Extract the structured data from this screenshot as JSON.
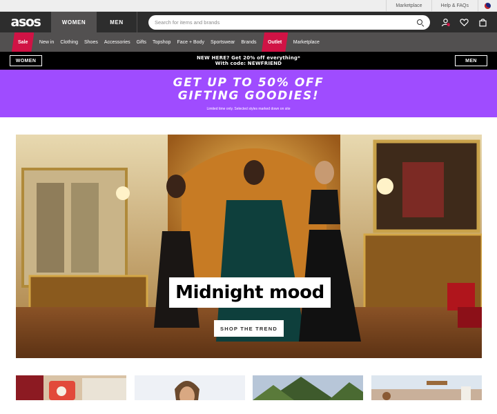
{
  "utility_bar": {
    "links": [
      "Marketplace",
      "Help & FAQs"
    ],
    "country_flag_icon": "flag-icon"
  },
  "header": {
    "logo": "asos",
    "tabs": [
      "WOMEN",
      "MEN"
    ],
    "active_tab": "WOMEN",
    "search_placeholder": "Search for items and brands",
    "icons": [
      "search-icon",
      "account-icon",
      "heart-icon",
      "bag-icon"
    ]
  },
  "category_nav": {
    "items": [
      "Sale",
      "New in",
      "Clothing",
      "Shoes",
      "Accessories",
      "Gifts",
      "Topshop",
      "Face + Body",
      "Sportswear",
      "Brands",
      "Outlet",
      "Marketplace"
    ],
    "highlighted": [
      "Sale",
      "Outlet"
    ],
    "highlight_color": "#d01345"
  },
  "promo_strip": {
    "line1": "NEW HERE? Get 20% off everything*",
    "line2": "With code: NEWFRIEND",
    "left_button": "WOMEN",
    "right_button": "MEN"
  },
  "sale_banner": {
    "line1": "GET UP TO 50% OFF",
    "line2": "GIFTING GOODIES!",
    "fine_print": "Limited time only. Selected styles marked down on site",
    "background": "#9f4cff"
  },
  "hero": {
    "title": "Midnight mood",
    "cta": "SHOP THE TREND"
  },
  "tiles": [
    "gift-tile",
    "portrait-tile",
    "tree-tile",
    "decor-tile"
  ]
}
